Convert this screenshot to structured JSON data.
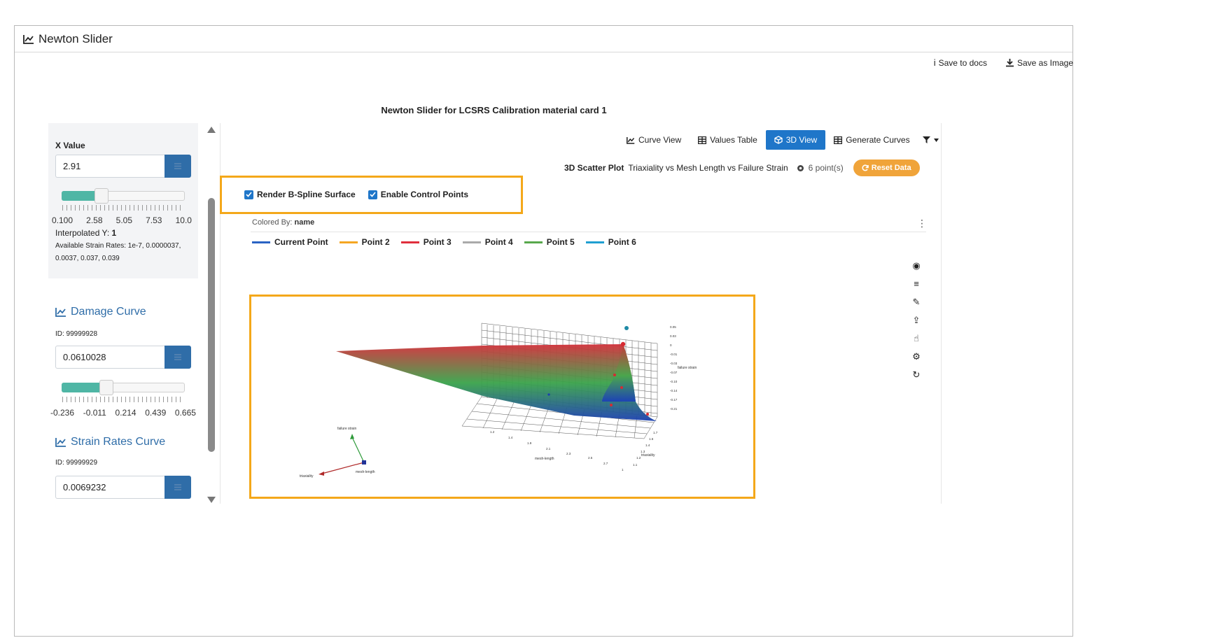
{
  "window": {
    "title": "Newton Slider"
  },
  "actions": {
    "save_docs": "Save to docs",
    "save_image": "Save as Image"
  },
  "heading": "Newton Slider for LCSRS Calibration material card 1",
  "x_value": {
    "label": "X Value",
    "value": "2.91",
    "slider_fraction": 0.29,
    "ticks": [
      "0.100",
      "2.58",
      "5.05",
      "7.53",
      "10.0"
    ],
    "interpolated_label": "Interpolated Y:",
    "interpolated_value": "1",
    "strain_rates_line1": "Available Strain Rates: 1e-7, 0.0000037,",
    "strain_rates_line2": "0.0037, 0.037, 0.039"
  },
  "damage_curve": {
    "title": "Damage Curve",
    "id": "ID: 99999928",
    "value": "0.0610028",
    "slider_fraction": 0.33,
    "ticks": [
      "-0.236",
      "-0.011",
      "0.214",
      "0.439",
      "0.665"
    ]
  },
  "strain_curve": {
    "title": "Strain Rates Curve",
    "id": "ID: 99999929",
    "value": "0.0069232"
  },
  "view_tabs": [
    {
      "label": "Curve View",
      "icon": "line-chart-icon",
      "active": false
    },
    {
      "label": "Values Table",
      "icon": "table-icon",
      "active": false
    },
    {
      "label": "3D View",
      "icon": "cube-icon",
      "active": true
    },
    {
      "label": "Generate Curves",
      "icon": "table-icon",
      "active": false
    }
  ],
  "scatter_info": {
    "bold": "3D Scatter Plot",
    "description": "Triaxiality vs Mesh Length vs Failure Strain",
    "points": "6 point(s)",
    "reset": "Reset Data"
  },
  "options": {
    "render_surface": "Render B-Spline Surface",
    "control_points": "Enable Control Points"
  },
  "colored_by": {
    "label": "Colored By:",
    "value": "name"
  },
  "legend": [
    {
      "name": "Current Point",
      "color": "#2a63c4"
    },
    {
      "name": "Point 2",
      "color": "#f5a623"
    },
    {
      "name": "Point 3",
      "color": "#e02f3c"
    },
    {
      "name": "Point 4",
      "color": "#aaaaaa"
    },
    {
      "name": "Point 5",
      "color": "#58a84c"
    },
    {
      "name": "Point 6",
      "color": "#1f9fd1"
    }
  ],
  "axes": {
    "failure": "failure strain",
    "triaxiality": "triaxiality",
    "mesh": "mesh-length",
    "mesh_axis_title": "mesh-length",
    "triax_axis_title": "triaxiality",
    "failure_axis_title": "failure strain"
  }
}
